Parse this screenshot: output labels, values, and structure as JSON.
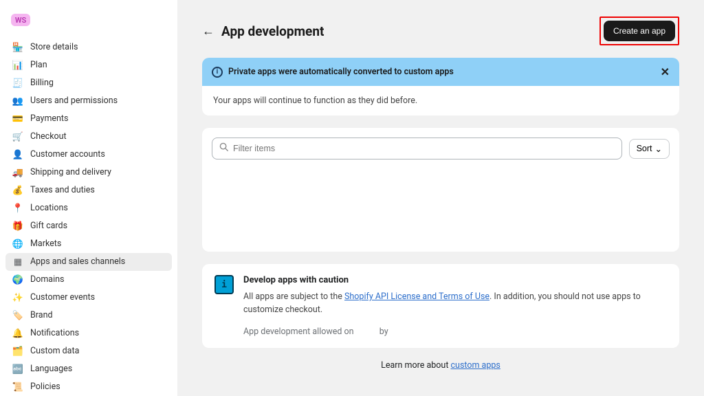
{
  "workspace_badge": "WS",
  "sidebar": {
    "items": [
      {
        "label": "Store details"
      },
      {
        "label": "Plan"
      },
      {
        "label": "Billing"
      },
      {
        "label": "Users and permissions"
      },
      {
        "label": "Payments"
      },
      {
        "label": "Checkout"
      },
      {
        "label": "Customer accounts"
      },
      {
        "label": "Shipping and delivery"
      },
      {
        "label": "Taxes and duties"
      },
      {
        "label": "Locations"
      },
      {
        "label": "Gift cards"
      },
      {
        "label": "Markets"
      },
      {
        "label": "Apps and sales channels"
      },
      {
        "label": "Domains"
      },
      {
        "label": "Customer events"
      },
      {
        "label": "Brand"
      },
      {
        "label": "Notifications"
      },
      {
        "label": "Custom data"
      },
      {
        "label": "Languages"
      },
      {
        "label": "Policies"
      }
    ]
  },
  "header": {
    "title": "App development",
    "create_button": "Create an app"
  },
  "banner": {
    "message": "Private apps were automatically converted to custom apps",
    "body": "Your apps will continue to function as they did before."
  },
  "filter": {
    "placeholder": "Filter items",
    "sort_label": "Sort"
  },
  "caution": {
    "title": "Develop apps with caution",
    "prefix": "All apps are subject to the ",
    "link_text": "Shopify API License and Terms of Use",
    "suffix": ". In addition, you should not use apps to customize checkout.",
    "allowed_prefix": "App development allowed on",
    "allowed_by": "by"
  },
  "learn_more": {
    "prefix": "Learn more about ",
    "link": "custom apps"
  }
}
